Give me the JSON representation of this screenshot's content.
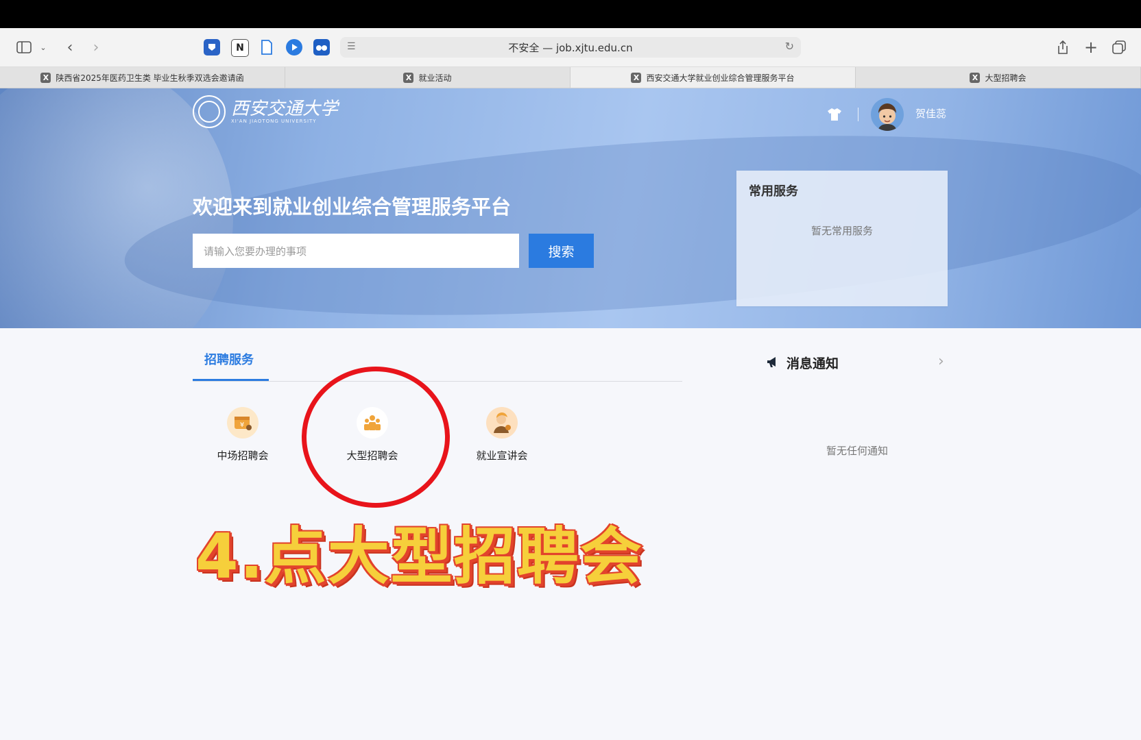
{
  "browser": {
    "address": "不安全 — job.xjtu.edu.cn",
    "tabs": [
      {
        "favicon": "X",
        "title": "陕西省2025年医药卫生类 毕业生秋季双选会邀请函"
      },
      {
        "favicon": "X",
        "title": "就业活动"
      },
      {
        "favicon": "X",
        "title": "西安交通大学就业创业综合管理服务平台"
      },
      {
        "favicon": "X",
        "title": "大型招聘会"
      }
    ]
  },
  "header": {
    "logo_text": "西安交通大学",
    "logo_subtext": "XI'AN JIAOTONG UNIVERSITY",
    "username": "贺佳蕊"
  },
  "hero": {
    "welcome": "欢迎来到就业创业综合管理服务平台",
    "search_placeholder": "请输入您要办理的事项",
    "search_button": "搜索"
  },
  "common_services": {
    "title": "常用服务",
    "empty": "暂无常用服务"
  },
  "recruitment": {
    "tab_label": "招聘服务",
    "items": [
      {
        "label": "中场招聘会"
      },
      {
        "label": "大型招聘会"
      },
      {
        "label": "就业宣讲会"
      }
    ]
  },
  "notices": {
    "title": "消息通知",
    "empty": "暂无任何通知"
  },
  "annotation": {
    "caption": "4.点大型招聘会"
  },
  "colors": {
    "accent": "#2b7be0",
    "annotation_red": "#e8141b",
    "caption_yellow": "#f6cf3b",
    "icon_orange": "#f0a43a"
  }
}
